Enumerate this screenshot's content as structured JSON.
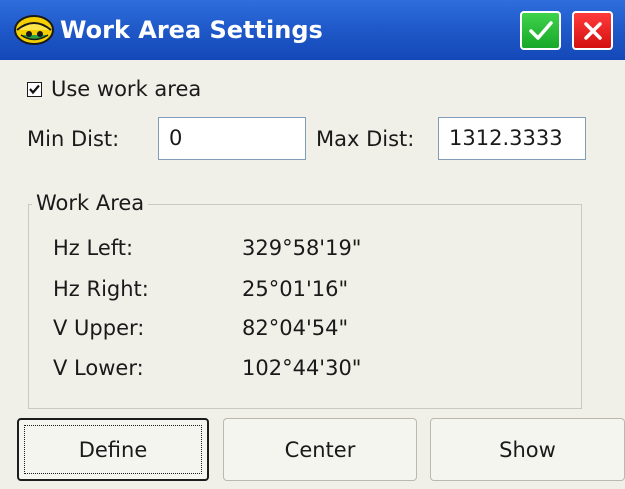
{
  "window": {
    "title": "Work Area Settings",
    "ok_icon": "checkmark-icon",
    "close_icon": "close-icon",
    "app_icon": "surveyor-hardhat-icon"
  },
  "options": {
    "use_work_area_label": "Use work area",
    "use_work_area_checked": true
  },
  "distance": {
    "min_label": "Min Dist:",
    "min_value": "0",
    "max_label": "Max Dist:",
    "max_value": "1312.3333"
  },
  "work_area": {
    "group_title": "Work Area",
    "rows": [
      {
        "label": "Hz Left:",
        "value": "329°58'19\""
      },
      {
        "label": "Hz Right:",
        "value": "25°01'16\""
      },
      {
        "label": "V Upper:",
        "value": "82°04'54\""
      },
      {
        "label": "V Lower:",
        "value": "102°44'30\""
      }
    ]
  },
  "buttons": {
    "define": "Define",
    "center": "Center",
    "show": "Show"
  },
  "colors": {
    "titlebar": "#1f58c8",
    "ok_green": "#22b534",
    "close_red": "#e21a1a",
    "background": "#f0f0e8"
  }
}
